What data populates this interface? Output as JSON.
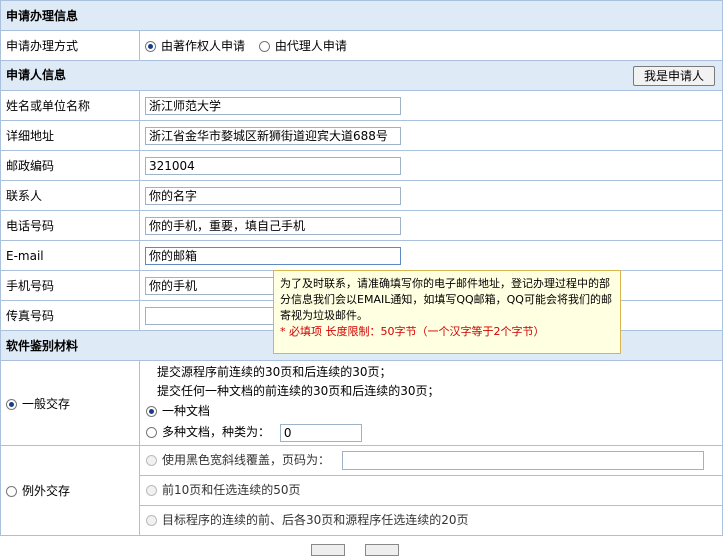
{
  "sections": {
    "apply_info": "申请办理信息",
    "applicant_info": "申请人信息",
    "materials": "软件鉴别材料"
  },
  "apply_method": {
    "label": "申请办理方式",
    "options": [
      "由著作权人申请",
      "由代理人申请"
    ],
    "selected": "由著作权人申请"
  },
  "applicant": {
    "self_button": "我是申请人",
    "fields": [
      {
        "label": "姓名或单位名称",
        "value": "浙江师范大学"
      },
      {
        "label": "详细地址",
        "value": "浙江省金华市婺城区新狮街道迎宾大道688号"
      },
      {
        "label": "邮政编码",
        "value": "321004"
      },
      {
        "label": "联系人",
        "value": "你的名字"
      },
      {
        "label": "电话号码",
        "value": "你的手机，重要，填自己手机"
      },
      {
        "label": "E-mail",
        "value": "你的邮箱"
      },
      {
        "label": "手机号码",
        "value": "你的手机"
      },
      {
        "label": "传真号码",
        "value": ""
      }
    ]
  },
  "tooltip": {
    "text": "为了及时联系，请准确填写你的电子邮件地址，登记办理过程中的部分信息我们会以EMAIL通知，如填写QQ邮箱，QQ可能会将我们的邮寄视为垃圾邮件。",
    "required": "* 必填项 长度限制：50字节（一个汉字等于2个字节）"
  },
  "materials": {
    "general": {
      "label": "一般交存",
      "line1": "提交源程序前连续的30页和后连续的30页；",
      "line2": "提交任何一种文档的前连续的30页和后连续的30页；",
      "one_doc": "一种文档",
      "multi_doc": "多种文档，种类为：",
      "doc_count": "0"
    },
    "exception": {
      "label": "例外交存",
      "opt1": "使用黑色宽斜线覆盖，页码为：",
      "opt2": "前10页和任选连续的50页",
      "opt3": "目标程序的连续的前、后各30页和源程序任选连续的20页"
    }
  }
}
